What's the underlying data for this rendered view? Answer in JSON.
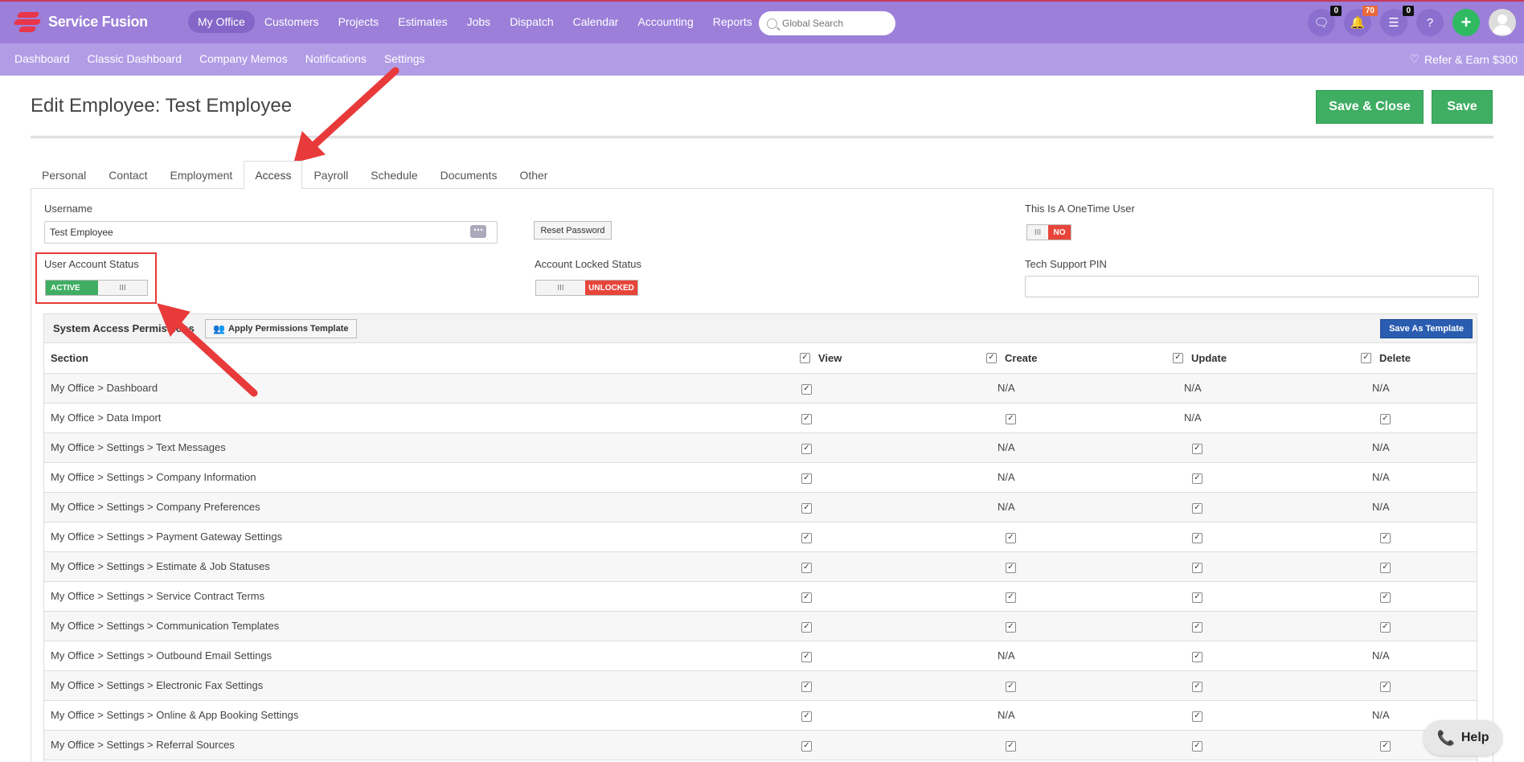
{
  "app": {
    "name": "Service Fusion"
  },
  "nav": [
    "My Office",
    "Customers",
    "Projects",
    "Estimates",
    "Jobs",
    "Dispatch",
    "Calendar",
    "Accounting",
    "Reports"
  ],
  "search": {
    "placeholder": "Global Search"
  },
  "badges": {
    "messages": "0",
    "notifications": "70",
    "tasks": "0"
  },
  "icons": {
    "help": "?",
    "add": "+"
  },
  "subnav": [
    "Dashboard",
    "Classic Dashboard",
    "Company Memos",
    "Notifications",
    "Settings"
  ],
  "refer": "Refer & Earn $300",
  "page": {
    "title": "Edit Employee: Test Employee",
    "save_close": "Save & Close",
    "save": "Save"
  },
  "tabs": [
    "Personal",
    "Contact",
    "Employment",
    "Access",
    "Payroll",
    "Schedule",
    "Documents",
    "Other"
  ],
  "form": {
    "username_label": "Username",
    "username_value": "Test Employee",
    "reset_password": "Reset Password",
    "onetime_label": "This Is A OneTime User",
    "onetime_value": "NO",
    "status_label": "User Account Status",
    "status_value": "ACTIVE",
    "locked_label": "Account Locked Status",
    "locked_value": "UNLOCKED",
    "pin_label": "Tech Support PIN",
    "toggle_handle": "III"
  },
  "permissions": {
    "title": "System Access Permissions",
    "apply_template": "Apply Permissions Template",
    "save_template": "Save As Template",
    "columns": [
      "Section",
      "View",
      "Create",
      "Update",
      "Delete"
    ],
    "rows": [
      {
        "section": "My Office > Dashboard",
        "view": "check",
        "create": "N/A",
        "update": "N/A",
        "delete": "N/A"
      },
      {
        "section": "My Office > Data Import",
        "view": "check",
        "create": "check",
        "update": "N/A",
        "delete": "check"
      },
      {
        "section": "My Office > Settings > Text Messages",
        "view": "check",
        "create": "N/A",
        "update": "check",
        "delete": "N/A"
      },
      {
        "section": "My Office > Settings > Company Information",
        "view": "check",
        "create": "N/A",
        "update": "check",
        "delete": "N/A"
      },
      {
        "section": "My Office > Settings > Company Preferences",
        "view": "check",
        "create": "N/A",
        "update": "check",
        "delete": "N/A"
      },
      {
        "section": "My Office > Settings > Payment Gateway Settings",
        "view": "check",
        "create": "check",
        "update": "check",
        "delete": "check"
      },
      {
        "section": "My Office > Settings > Estimate & Job Statuses",
        "view": "check",
        "create": "check",
        "update": "check",
        "delete": "check"
      },
      {
        "section": "My Office > Settings > Service Contract Terms",
        "view": "check",
        "create": "check",
        "update": "check",
        "delete": "check"
      },
      {
        "section": "My Office > Settings > Communication Templates",
        "view": "check",
        "create": "check",
        "update": "check",
        "delete": "check"
      },
      {
        "section": "My Office > Settings > Outbound Email Settings",
        "view": "check",
        "create": "N/A",
        "update": "check",
        "delete": "N/A"
      },
      {
        "section": "My Office > Settings > Electronic Fax Settings",
        "view": "check",
        "create": "check",
        "update": "check",
        "delete": "check"
      },
      {
        "section": "My Office > Settings > Online & App Booking Settings",
        "view": "check",
        "create": "N/A",
        "update": "check",
        "delete": "N/A"
      },
      {
        "section": "My Office > Settings > Referral Sources",
        "view": "check",
        "create": "check",
        "update": "check",
        "delete": "check"
      }
    ]
  },
  "help": "Help",
  "colors": {
    "topbar": "#9b7fd9",
    "subbar": "#b39ce6",
    "green": "#3fae63",
    "red": "#e8453a",
    "blue": "#2a5db0",
    "annotation": "#e83a3a"
  }
}
